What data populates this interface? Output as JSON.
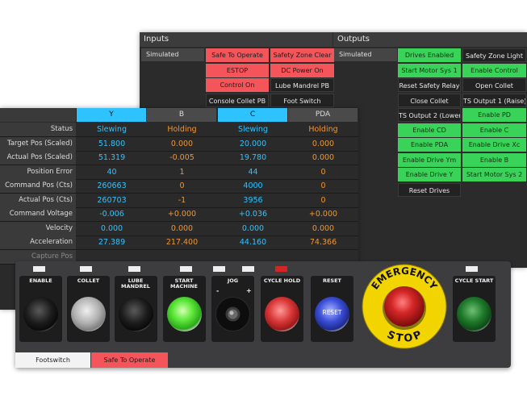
{
  "io": {
    "inputs_title": "Inputs",
    "outputs_title": "Outputs",
    "inputs_sim": "Simulated",
    "outputs_sim": "Simulated",
    "inputs": [
      {
        "label": "Safe To Operate",
        "state": "red"
      },
      {
        "label": "Safety Zone Clear",
        "state": "red"
      },
      {
        "label": "ESTOP",
        "state": "red"
      },
      {
        "label": "DC Power On",
        "state": "red"
      },
      {
        "label": "Control On",
        "state": "red"
      },
      {
        "label": "Lube Mandrel PB",
        "state": "dark"
      },
      {
        "label": "Console Collet PB",
        "state": "dark"
      },
      {
        "label": "Foot Switch",
        "state": "dark"
      }
    ],
    "outputs": [
      {
        "label": "Drives Enabled",
        "state": "green"
      },
      {
        "label": "Safety Zone Light",
        "state": "dark"
      },
      {
        "label": "Start Motor Sys 1",
        "state": "green"
      },
      {
        "label": "Enable Control",
        "state": "green"
      },
      {
        "label": "Reset Safety Relay",
        "state": "dark"
      },
      {
        "label": "Open Collet",
        "state": "dark"
      },
      {
        "label": "Close Collet",
        "state": "dark"
      },
      {
        "label": "TS Output 1 (Raise)",
        "state": "dark"
      },
      {
        "label": "TS Output 2 (Lower)",
        "state": "dark"
      },
      {
        "label": "Enable PD",
        "state": "green"
      },
      {
        "label": "Enable CD",
        "state": "green"
      },
      {
        "label": "Enable C",
        "state": "green"
      },
      {
        "label": "Enable PDA",
        "state": "green"
      },
      {
        "label": "Enable Drive Xc",
        "state": "green"
      },
      {
        "label": "Enable Drive Ym",
        "state": "green"
      },
      {
        "label": "Enable B",
        "state": "green"
      },
      {
        "label": "Enable Drive Y",
        "state": "green"
      },
      {
        "label": "Start Motor Sys 2",
        "state": "green"
      },
      {
        "label": "Reset Drives",
        "state": "dark"
      }
    ]
  },
  "axes": {
    "columns": [
      {
        "name": "Y",
        "color": "#2ec3ff"
      },
      {
        "name": "B",
        "color": "#4a4a4a"
      },
      {
        "name": "C",
        "color": "#2ec3ff"
      },
      {
        "name": "PDA",
        "color": "#4a4a4a"
      }
    ],
    "rows": [
      {
        "label": "Status",
        "values": [
          "Slewing",
          "Holding",
          "Slewing",
          "Holding"
        ]
      },
      {
        "label": "Target Pos (Scaled)",
        "values": [
          "51.800",
          "0.000",
          "20.000",
          "0.000"
        ]
      },
      {
        "label": "Actual Pos (Scaled)",
        "values": [
          "51.319",
          "-0.005",
          "19.780",
          "0.000"
        ]
      },
      {
        "label": "Position Error",
        "values": [
          "40",
          "1",
          "44",
          "0"
        ]
      },
      {
        "label": "Command Pos (Cts)",
        "values": [
          "260663",
          "0",
          "4000",
          "0"
        ]
      },
      {
        "label": "Actual Pos (Cts)",
        "values": [
          "260703",
          "-1",
          "3956",
          "0"
        ]
      },
      {
        "label": "Command Voltage",
        "values": [
          "-0.006",
          "+0.000",
          "+0.036",
          "+0.000"
        ]
      },
      {
        "label": "Velocity",
        "values": [
          "0.000",
          "0.000",
          "0.000",
          "0.000"
        ]
      },
      {
        "label": "Acceleration",
        "values": [
          "27.389",
          "217.400",
          "44.160",
          "74.366"
        ]
      },
      {
        "label": "Capture Pos",
        "values": [
          "",
          "",
          "",
          ""
        ]
      }
    ]
  },
  "control": {
    "buttons": [
      {
        "label": "ENABLE",
        "knob": "black"
      },
      {
        "label": "COLLET",
        "knob": "gray"
      },
      {
        "label": "LUBE MANDREL",
        "knob": "black"
      },
      {
        "label": "START MACHINE",
        "knob": "green"
      },
      {
        "label": "JOG",
        "knob": "jog"
      },
      {
        "label": "CYCLE HOLD",
        "knob": "red"
      },
      {
        "label": "RESET",
        "knob": "blue",
        "inner": "RESET"
      },
      {
        "label": "CYCLE START",
        "knob": "dgreen"
      }
    ],
    "jog_minus": "-",
    "jog_plus": "+",
    "estop_top": "EMERGENCY",
    "estop_bottom": "STOP",
    "lamp_red": "#d42525"
  },
  "bottom": {
    "footswitch": "Footswitch",
    "safe": "Safe To Operate"
  },
  "colors": {
    "red": "#f4555b",
    "green": "#3ad35a",
    "blue": "#2ec3ff",
    "orange": "#f0962e"
  }
}
